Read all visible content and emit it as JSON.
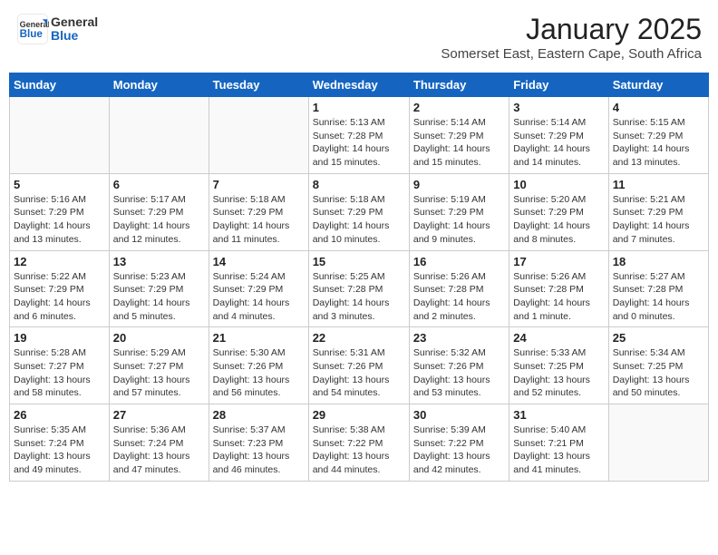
{
  "header": {
    "logo_general": "General",
    "logo_blue": "Blue",
    "month_title": "January 2025",
    "subtitle": "Somerset East, Eastern Cape, South Africa"
  },
  "weekdays": [
    "Sunday",
    "Monday",
    "Tuesday",
    "Wednesday",
    "Thursday",
    "Friday",
    "Saturday"
  ],
  "weeks": [
    [
      {
        "day": "",
        "info": ""
      },
      {
        "day": "",
        "info": ""
      },
      {
        "day": "",
        "info": ""
      },
      {
        "day": "1",
        "info": "Sunrise: 5:13 AM\nSunset: 7:28 PM\nDaylight: 14 hours\nand 15 minutes."
      },
      {
        "day": "2",
        "info": "Sunrise: 5:14 AM\nSunset: 7:29 PM\nDaylight: 14 hours\nand 15 minutes."
      },
      {
        "day": "3",
        "info": "Sunrise: 5:14 AM\nSunset: 7:29 PM\nDaylight: 14 hours\nand 14 minutes."
      },
      {
        "day": "4",
        "info": "Sunrise: 5:15 AM\nSunset: 7:29 PM\nDaylight: 14 hours\nand 13 minutes."
      }
    ],
    [
      {
        "day": "5",
        "info": "Sunrise: 5:16 AM\nSunset: 7:29 PM\nDaylight: 14 hours\nand 13 minutes."
      },
      {
        "day": "6",
        "info": "Sunrise: 5:17 AM\nSunset: 7:29 PM\nDaylight: 14 hours\nand 12 minutes."
      },
      {
        "day": "7",
        "info": "Sunrise: 5:18 AM\nSunset: 7:29 PM\nDaylight: 14 hours\nand 11 minutes."
      },
      {
        "day": "8",
        "info": "Sunrise: 5:18 AM\nSunset: 7:29 PM\nDaylight: 14 hours\nand 10 minutes."
      },
      {
        "day": "9",
        "info": "Sunrise: 5:19 AM\nSunset: 7:29 PM\nDaylight: 14 hours\nand 9 minutes."
      },
      {
        "day": "10",
        "info": "Sunrise: 5:20 AM\nSunset: 7:29 PM\nDaylight: 14 hours\nand 8 minutes."
      },
      {
        "day": "11",
        "info": "Sunrise: 5:21 AM\nSunset: 7:29 PM\nDaylight: 14 hours\nand 7 minutes."
      }
    ],
    [
      {
        "day": "12",
        "info": "Sunrise: 5:22 AM\nSunset: 7:29 PM\nDaylight: 14 hours\nand 6 minutes."
      },
      {
        "day": "13",
        "info": "Sunrise: 5:23 AM\nSunset: 7:29 PM\nDaylight: 14 hours\nand 5 minutes."
      },
      {
        "day": "14",
        "info": "Sunrise: 5:24 AM\nSunset: 7:29 PM\nDaylight: 14 hours\nand 4 minutes."
      },
      {
        "day": "15",
        "info": "Sunrise: 5:25 AM\nSunset: 7:28 PM\nDaylight: 14 hours\nand 3 minutes."
      },
      {
        "day": "16",
        "info": "Sunrise: 5:26 AM\nSunset: 7:28 PM\nDaylight: 14 hours\nand 2 minutes."
      },
      {
        "day": "17",
        "info": "Sunrise: 5:26 AM\nSunset: 7:28 PM\nDaylight: 14 hours\nand 1 minute."
      },
      {
        "day": "18",
        "info": "Sunrise: 5:27 AM\nSunset: 7:28 PM\nDaylight: 14 hours\nand 0 minutes."
      }
    ],
    [
      {
        "day": "19",
        "info": "Sunrise: 5:28 AM\nSunset: 7:27 PM\nDaylight: 13 hours\nand 58 minutes."
      },
      {
        "day": "20",
        "info": "Sunrise: 5:29 AM\nSunset: 7:27 PM\nDaylight: 13 hours\nand 57 minutes."
      },
      {
        "day": "21",
        "info": "Sunrise: 5:30 AM\nSunset: 7:26 PM\nDaylight: 13 hours\nand 56 minutes."
      },
      {
        "day": "22",
        "info": "Sunrise: 5:31 AM\nSunset: 7:26 PM\nDaylight: 13 hours\nand 54 minutes."
      },
      {
        "day": "23",
        "info": "Sunrise: 5:32 AM\nSunset: 7:26 PM\nDaylight: 13 hours\nand 53 minutes."
      },
      {
        "day": "24",
        "info": "Sunrise: 5:33 AM\nSunset: 7:25 PM\nDaylight: 13 hours\nand 52 minutes."
      },
      {
        "day": "25",
        "info": "Sunrise: 5:34 AM\nSunset: 7:25 PM\nDaylight: 13 hours\nand 50 minutes."
      }
    ],
    [
      {
        "day": "26",
        "info": "Sunrise: 5:35 AM\nSunset: 7:24 PM\nDaylight: 13 hours\nand 49 minutes."
      },
      {
        "day": "27",
        "info": "Sunrise: 5:36 AM\nSunset: 7:24 PM\nDaylight: 13 hours\nand 47 minutes."
      },
      {
        "day": "28",
        "info": "Sunrise: 5:37 AM\nSunset: 7:23 PM\nDaylight: 13 hours\nand 46 minutes."
      },
      {
        "day": "29",
        "info": "Sunrise: 5:38 AM\nSunset: 7:22 PM\nDaylight: 13 hours\nand 44 minutes."
      },
      {
        "day": "30",
        "info": "Sunrise: 5:39 AM\nSunset: 7:22 PM\nDaylight: 13 hours\nand 42 minutes."
      },
      {
        "day": "31",
        "info": "Sunrise: 5:40 AM\nSunset: 7:21 PM\nDaylight: 13 hours\nand 41 minutes."
      },
      {
        "day": "",
        "info": ""
      }
    ]
  ]
}
